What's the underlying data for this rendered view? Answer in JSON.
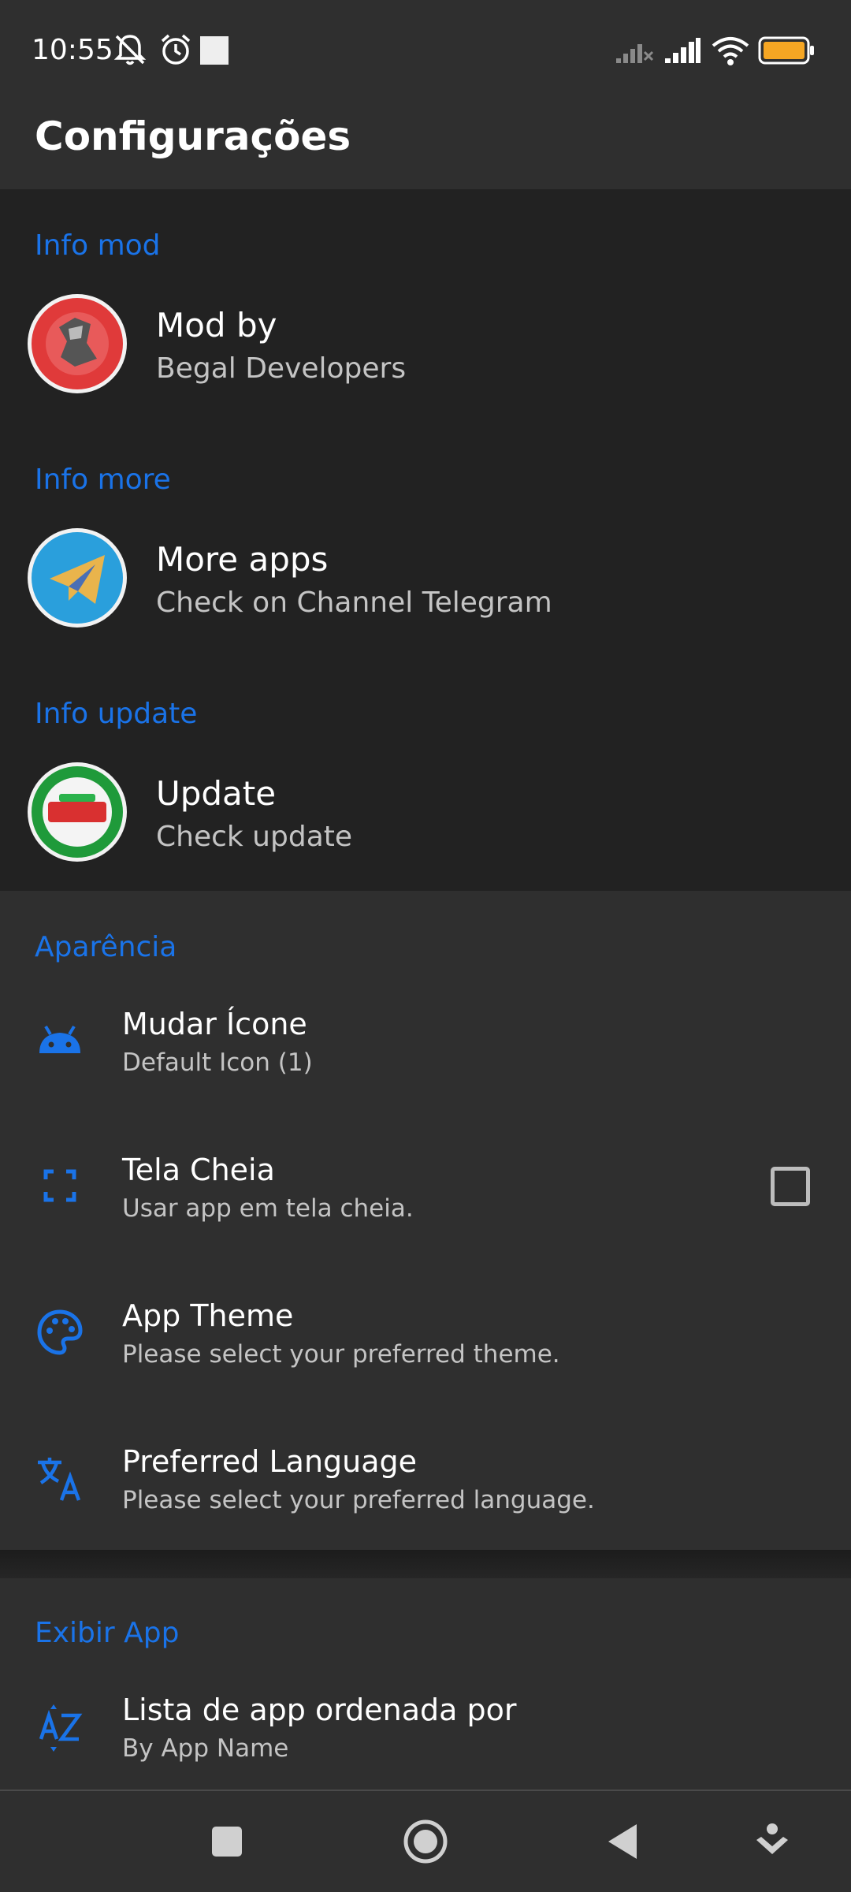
{
  "status_bar": {
    "time": "10:55",
    "icons": [
      "notifications-off-icon",
      "alarm-icon",
      "square-notification-icon",
      "signal-nodata-icon",
      "signal-icon",
      "wifi-icon",
      "battery-icon"
    ]
  },
  "app_bar": {
    "title": "Configurações"
  },
  "sections": {
    "info_mod": {
      "title": "Info mod",
      "item": {
        "title": "Mod by",
        "subtitle": "Begal Developers"
      }
    },
    "info_more": {
      "title": "Info more",
      "item": {
        "title": "More apps",
        "subtitle": "Check on Channel Telegram"
      }
    },
    "info_update": {
      "title": "Info update",
      "item": {
        "title": "Update",
        "subtitle": "Check update"
      }
    },
    "aparencia": {
      "title": "Aparência",
      "items": [
        {
          "icon": "android-icon",
          "title": "Mudar Ícone",
          "subtitle": "Default Icon (1)"
        },
        {
          "icon": "fullscreen-icon",
          "title": "Tela Cheia",
          "subtitle": "Usar app em tela cheia.",
          "checked": false
        },
        {
          "icon": "palette-icon",
          "title": "App Theme",
          "subtitle": "Please select your preferred theme."
        },
        {
          "icon": "translate-icon",
          "title": "Preferred Language",
          "subtitle": "Please select your preferred language."
        }
      ]
    },
    "exibir_app": {
      "title": "Exibir App",
      "items": [
        {
          "icon": "sort-az-icon",
          "title": "Lista de app ordenada por",
          "subtitle": "By App Name"
        }
      ]
    }
  },
  "nav_bar": {
    "buttons": [
      "recents-icon",
      "home-icon",
      "back-icon",
      "assistant-icon"
    ]
  },
  "colors": {
    "accent": "#1a73e8",
    "background": "#2f2f2f",
    "mod_background": "#222222",
    "battery": "#f5a623"
  }
}
